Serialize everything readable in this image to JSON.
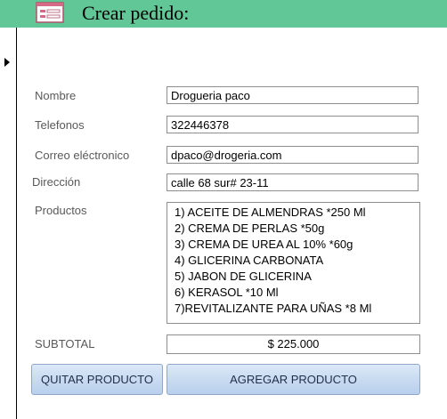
{
  "header": {
    "title": "Crear pedido:",
    "icon": "form-icon",
    "background": "#62c796"
  },
  "form": {
    "nombre": {
      "label": "Nombre",
      "value": "Drogueria paco"
    },
    "telefonos": {
      "label": "Telefonos",
      "value": "322446378"
    },
    "correo": {
      "label": "Correo eléctronico",
      "value": "dpaco@drogeria.com"
    },
    "direccion": {
      "label": "Dirección",
      "value": "calle 68 sur# 23-11"
    },
    "productos": {
      "label": "Productos",
      "items": [
        "1)  ACEITE DE ALMENDRAS *250 Ml",
        "2)  CREMA DE PERLAS *50g",
        "3)  CREMA DE UREA AL 10% *60g",
        "4) GLICERINA CARBONATA",
        "5) JABON DE GLICERINA",
        "6) KERASOL *10 Ml",
        "7)REVITALIZANTE PARA UÑAS *8 Ml"
      ]
    },
    "subtotal": {
      "label": "SUBTOTAL",
      "value": "$ 225.000"
    }
  },
  "buttons": {
    "quitar": "QUITAR PRODUCTO",
    "agregar": "AGREGAR PRODUCTO"
  }
}
